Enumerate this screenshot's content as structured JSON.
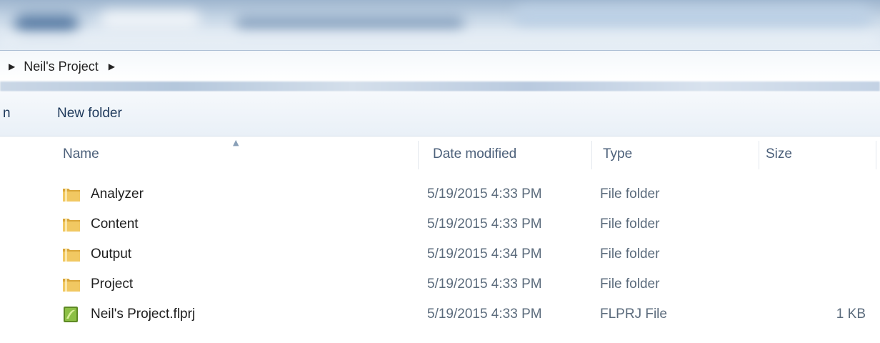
{
  "address": {
    "crumb": "Neil's Project"
  },
  "toolbar": {
    "cut_label": "n",
    "new_folder_label": "New folder"
  },
  "columns": {
    "name": "Name",
    "date": "Date modified",
    "type": "Type",
    "size": "Size"
  },
  "files": [
    {
      "name": "Analyzer",
      "date": "5/19/2015 4:33 PM",
      "type": "File folder",
      "size": "",
      "icon": "folder-icon"
    },
    {
      "name": "Content",
      "date": "5/19/2015 4:33 PM",
      "type": "File folder",
      "size": "",
      "icon": "folder-icon"
    },
    {
      "name": "Output",
      "date": "5/19/2015 4:34 PM",
      "type": "File folder",
      "size": "",
      "icon": "folder-icon"
    },
    {
      "name": "Project",
      "date": "5/19/2015 4:33 PM",
      "type": "File folder",
      "size": "",
      "icon": "folder-icon"
    },
    {
      "name": "Neil's Project.flprj",
      "date": "5/19/2015 4:33 PM",
      "type": "FLPRJ File",
      "size": "1 KB",
      "icon": "project-file-icon"
    }
  ],
  "colors": {
    "folder": "#e8b84a",
    "file": "#7aa23a",
    "text_blue": "#1e395b"
  }
}
